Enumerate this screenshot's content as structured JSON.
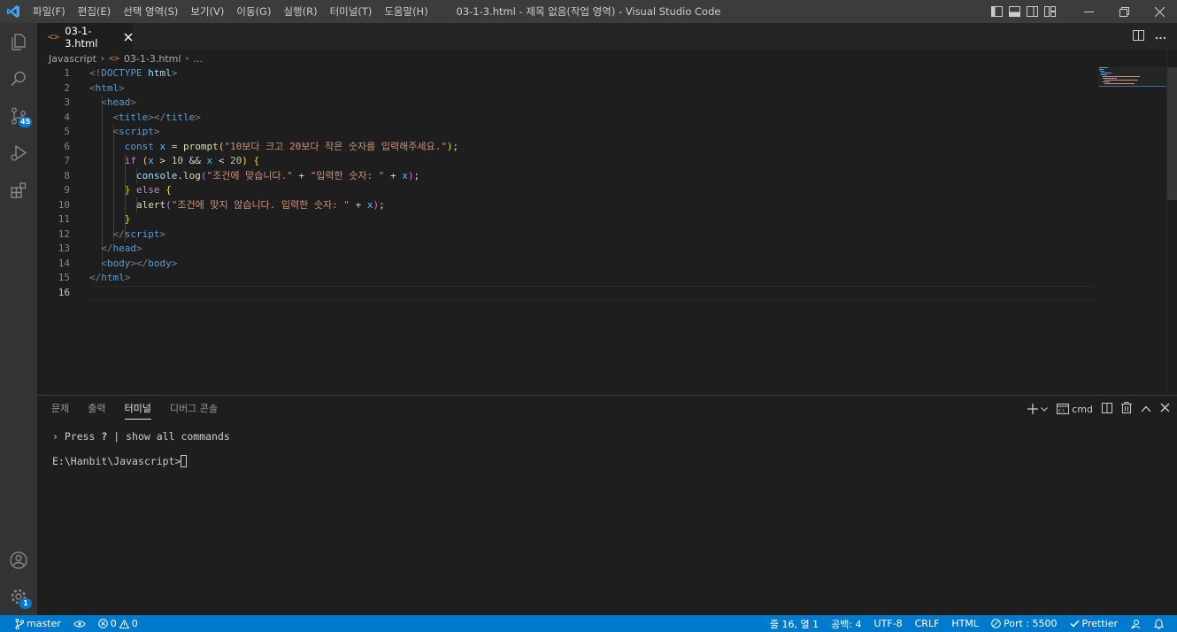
{
  "window": {
    "title": "03-1-3.html - 제목 없음(작업 영역) - Visual Studio Code"
  },
  "menu": [
    "파일(F)",
    "편집(E)",
    "선택 영역(S)",
    "보기(V)",
    "이동(G)",
    "실행(R)",
    "터미널(T)",
    "도움말(H)"
  ],
  "activity_bar": {
    "source_control_badge": "45",
    "settings_badge": "1",
    "icons": [
      "explorer-icon",
      "search-icon",
      "source-control-icon",
      "run-debug-icon",
      "extensions-icon",
      "account-icon",
      "settings-gear-icon"
    ]
  },
  "tab": {
    "label": "03-1-3.html"
  },
  "breadcrumb": {
    "folder": "Javascript",
    "file": "03-1-3.html",
    "more": "..."
  },
  "editor": {
    "line_numbers": [
      "1",
      "2",
      "3",
      "4",
      "5",
      "6",
      "7",
      "8",
      "9",
      "10",
      "11",
      "12",
      "13",
      "14",
      "15",
      "16"
    ],
    "active_line": 16
  },
  "panel": {
    "tabs": [
      "문제",
      "출력",
      "터미널",
      "디버그 콘솔"
    ],
    "active_tab": "터미널",
    "shell": "cmd",
    "hint_prefix": "› Press",
    "hint_key": "?",
    "hint_text": "| show all commands",
    "prompt": "E:\\Hanbit\\Javascript>"
  },
  "status": {
    "branch": "master",
    "errors": "0",
    "warnings": "0",
    "cursor": "줄 16, 열 1",
    "indent": "공백: 4",
    "encoding": "UTF-8",
    "eol": "CRLF",
    "language": "HTML",
    "port": "Port : 5500",
    "prettier": "Prettier"
  },
  "colors": {
    "statusbar": "#007acc",
    "titlebar": "#3c3c3c",
    "activitybar": "#333333",
    "editor_bg": "#1e1e1e",
    "badge": "#0078d4"
  }
}
